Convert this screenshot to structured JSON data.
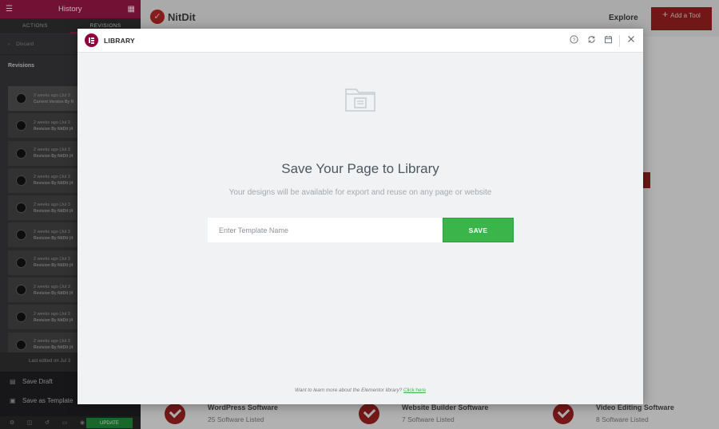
{
  "sidebar": {
    "header_title": "History",
    "tabs": [
      {
        "label": "ACTIONS",
        "active": false
      },
      {
        "label": "REVISIONS",
        "active": true
      }
    ],
    "discard_label": "Discard",
    "revisions_title": "Revisions",
    "revisions": [
      {
        "time": "2 weeks ago (Jul 3",
        "by": "Current Version By N"
      },
      {
        "time": "2 weeks ago (Jul 3",
        "by": "Revision By NitDit (4"
      },
      {
        "time": "2 weeks ago (Jul 3",
        "by": "Revision By NitDit (4"
      },
      {
        "time": "2 weeks ago (Jul 3",
        "by": "Revision By NitDit (4"
      },
      {
        "time": "2 weeks ago (Jul 3",
        "by": "Revision By NitDit (4"
      },
      {
        "time": "2 weeks ago (Jul 3",
        "by": "Revision By NitDit (4"
      },
      {
        "time": "2 weeks ago (Jul 3",
        "by": "Revision By NitDit (4"
      },
      {
        "time": "2 weeks ago (Jul 3",
        "by": "Revision By NitDit (4"
      },
      {
        "time": "2 weeks ago (Jul 3",
        "by": "Revision By NitDit (4"
      },
      {
        "time": "2 weeks ago (Jul 3",
        "by": "Revision By NitDit (4"
      }
    ],
    "last_edited": "Last edited on Jul 3",
    "menu": [
      {
        "label": "Save Draft",
        "icon": "draft-icon"
      },
      {
        "label": "Save as Template",
        "icon": "folder-icon"
      }
    ],
    "update_label": "UPDATE"
  },
  "page": {
    "logo_text": "NitDit",
    "explore_label": "Explore",
    "add_tool_label": "Add a Tool",
    "categories": [
      {
        "name": "WordPress Software",
        "count": "25 Software Listed"
      },
      {
        "name": "Website Builder Software",
        "count": "7 Software Listed"
      },
      {
        "name": "Video Editing Software",
        "count": "8 Software Listed"
      }
    ]
  },
  "modal": {
    "title": "LIBRARY",
    "header_icons": [
      "help-icon",
      "sync-icon",
      "calendar-icon",
      "close-icon"
    ],
    "heading": "Save Your Page to Library",
    "subheading": "Your designs will be available for export and reuse on any page or website",
    "input_placeholder": "Enter Template Name",
    "save_label": "SAVE",
    "learn_text": "Want to learn more about the Elementor library?",
    "learn_link": "Click here"
  },
  "colors": {
    "brand": "#92003b",
    "save_green": "#39b54a",
    "sidebar_header": "#8c1540",
    "site_accent": "#8f1e1e"
  }
}
